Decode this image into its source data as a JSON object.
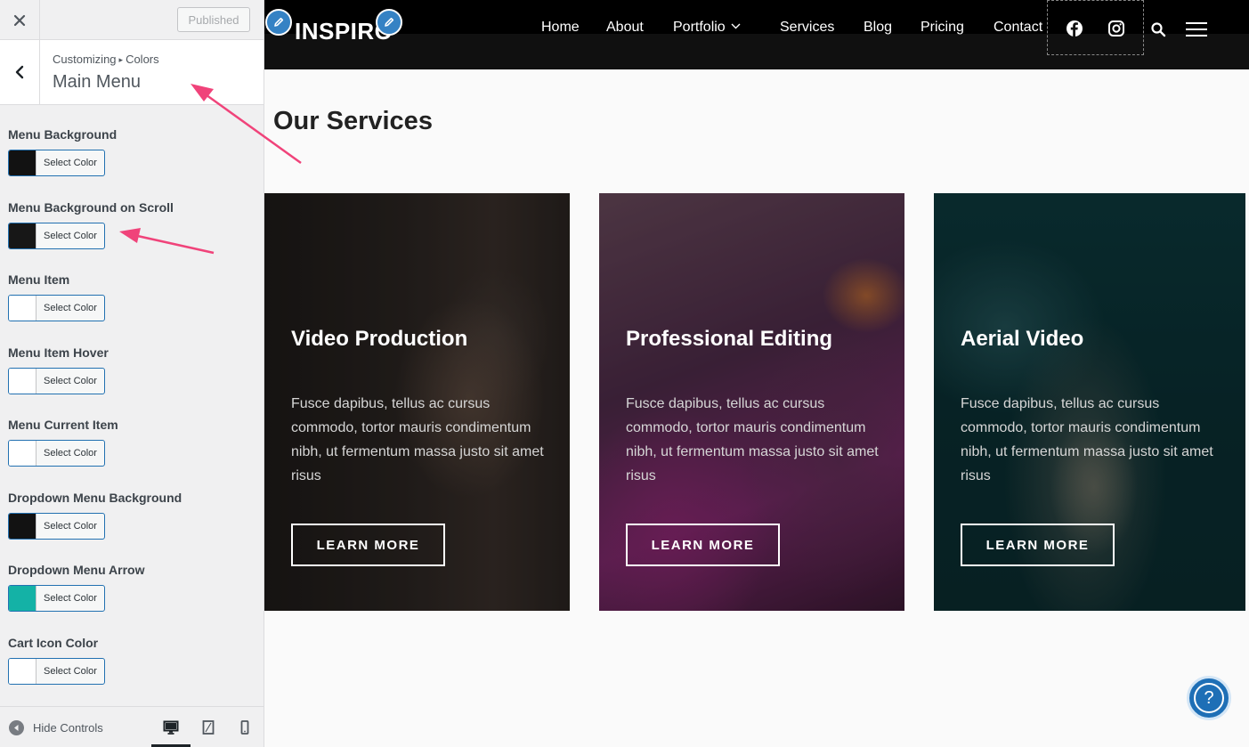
{
  "sidebar": {
    "publish_label": "Published",
    "breadcrumb": {
      "root": "Customizing",
      "separator": "▸",
      "section": "Colors"
    },
    "section_title": "Main Menu",
    "select_color_label": "Select Color",
    "controls": [
      {
        "label": "Menu Background",
        "color": "#121212"
      },
      {
        "label": "Menu Background on Scroll",
        "color": "#171717"
      },
      {
        "label": "Menu Item",
        "color": "#ffffff"
      },
      {
        "label": "Menu Item Hover",
        "color": "#ffffff"
      },
      {
        "label": "Menu Current Item",
        "color": "#ffffff"
      },
      {
        "label": "Dropdown Menu Background",
        "color": "#121212"
      },
      {
        "label": "Dropdown Menu Arrow",
        "color": "#14b2a6"
      },
      {
        "label": "Cart Icon Color",
        "color": "#ffffff"
      }
    ],
    "footer": {
      "hide_controls_label": "Hide Controls"
    }
  },
  "site": {
    "logo": "INSPIRO",
    "nav": [
      "Home",
      "About",
      "Portfolio",
      "Services",
      "Blog",
      "Pricing",
      "Contact"
    ],
    "section_title": "Our Services",
    "cards": [
      {
        "title": "Video Production",
        "text": "Fusce dapibus, tellus ac cursus commodo, tortor mauris condimentum nibh, ut fermentum massa justo sit amet risus",
        "button": "LEARN MORE"
      },
      {
        "title": "Professional Editing",
        "text": "Fusce dapibus, tellus ac cursus commodo, tortor mauris condimentum nibh, ut fermentum massa justo sit amet risus",
        "button": "LEARN MORE"
      },
      {
        "title": "Aerial Video",
        "text": "Fusce dapibus, tellus ac cursus commodo, tortor mauris condimentum nibh, ut fermentum massa justo sit amet risus",
        "button": "LEARN MORE"
      }
    ],
    "help_label": "?"
  },
  "colors": {
    "accent": "#2271b1",
    "annotation_arrow": "#f0437a",
    "header_bg": "#101010",
    "edit_pen": "#3582c4"
  }
}
